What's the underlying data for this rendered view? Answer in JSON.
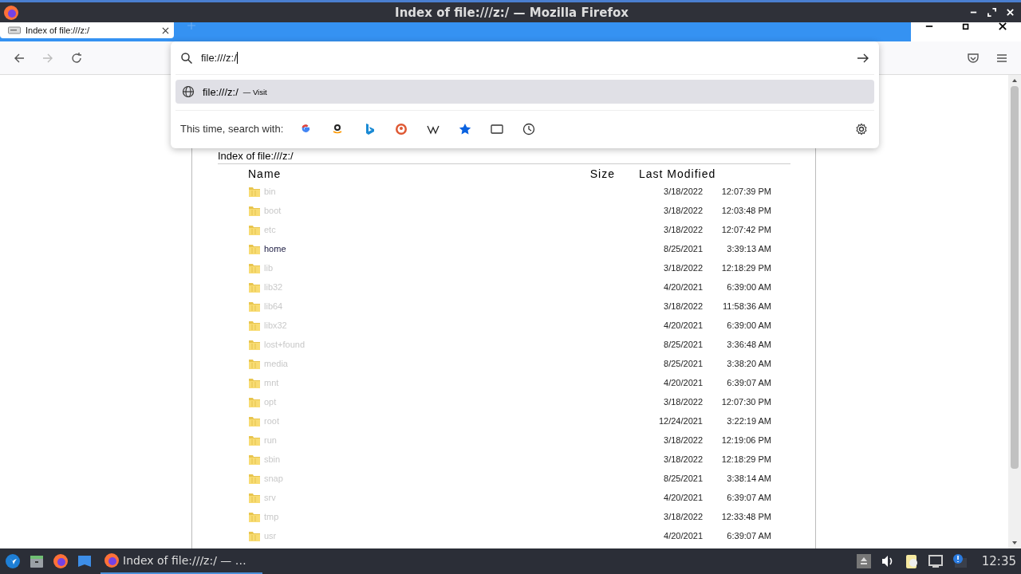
{
  "window": {
    "title": "Index of file:///z:/ — Mozilla Firefox"
  },
  "tabs": [
    {
      "label": "Index of file:///z:/",
      "selected": true
    }
  ],
  "address_bar": {
    "value": "file:///z:/"
  },
  "suggestions": [
    {
      "url": "file:///z:/",
      "action": "— Visit",
      "selected": true
    }
  ],
  "search_with": {
    "label": "This time, search with:"
  },
  "page": {
    "heading": "Index of file:///z:/",
    "columns": [
      "Name",
      "Size",
      "Last Modified"
    ],
    "rows": [
      {
        "name": "bin",
        "dimmed": true,
        "date": "3/18/2022",
        "time": "12:07:39 PM"
      },
      {
        "name": "boot",
        "dimmed": true,
        "date": "3/18/2022",
        "time": "12:03:48 PM"
      },
      {
        "name": "etc",
        "dimmed": true,
        "date": "3/18/2022",
        "time": "12:07:42 PM"
      },
      {
        "name": "home",
        "dimmed": false,
        "date": "8/25/2021",
        "time": "3:39:13 AM"
      },
      {
        "name": "lib",
        "dimmed": true,
        "date": "3/18/2022",
        "time": "12:18:29 PM"
      },
      {
        "name": "lib32",
        "dimmed": true,
        "date": "4/20/2021",
        "time": "6:39:00 AM"
      },
      {
        "name": "lib64",
        "dimmed": true,
        "date": "3/18/2022",
        "time": "11:58:36 AM"
      },
      {
        "name": "libx32",
        "dimmed": true,
        "date": "4/20/2021",
        "time": "6:39:00 AM"
      },
      {
        "name": "lost+found",
        "dimmed": true,
        "date": "8/25/2021",
        "time": "3:36:48 AM"
      },
      {
        "name": "media",
        "dimmed": true,
        "date": "8/25/2021",
        "time": "3:38:20 AM"
      },
      {
        "name": "mnt",
        "dimmed": true,
        "date": "4/20/2021",
        "time": "6:39:07 AM"
      },
      {
        "name": "opt",
        "dimmed": true,
        "date": "3/18/2022",
        "time": "12:07:30 PM"
      },
      {
        "name": "root",
        "dimmed": true,
        "date": "12/24/2021",
        "time": "3:22:19 AM"
      },
      {
        "name": "run",
        "dimmed": true,
        "date": "3/18/2022",
        "time": "12:19:06 PM"
      },
      {
        "name": "sbin",
        "dimmed": true,
        "date": "3/18/2022",
        "time": "12:18:29 PM"
      },
      {
        "name": "snap",
        "dimmed": true,
        "date": "8/25/2021",
        "time": "3:38:14 AM"
      },
      {
        "name": "srv",
        "dimmed": true,
        "date": "4/20/2021",
        "time": "6:39:07 AM"
      },
      {
        "name": "tmp",
        "dimmed": true,
        "date": "3/18/2022",
        "time": "12:33:48 PM"
      },
      {
        "name": "usr",
        "dimmed": true,
        "date": "4/20/2021",
        "time": "6:39:07 AM"
      }
    ]
  },
  "taskbar": {
    "window_label": "Index of file:///z:/ — …",
    "clock": "12:35"
  }
}
